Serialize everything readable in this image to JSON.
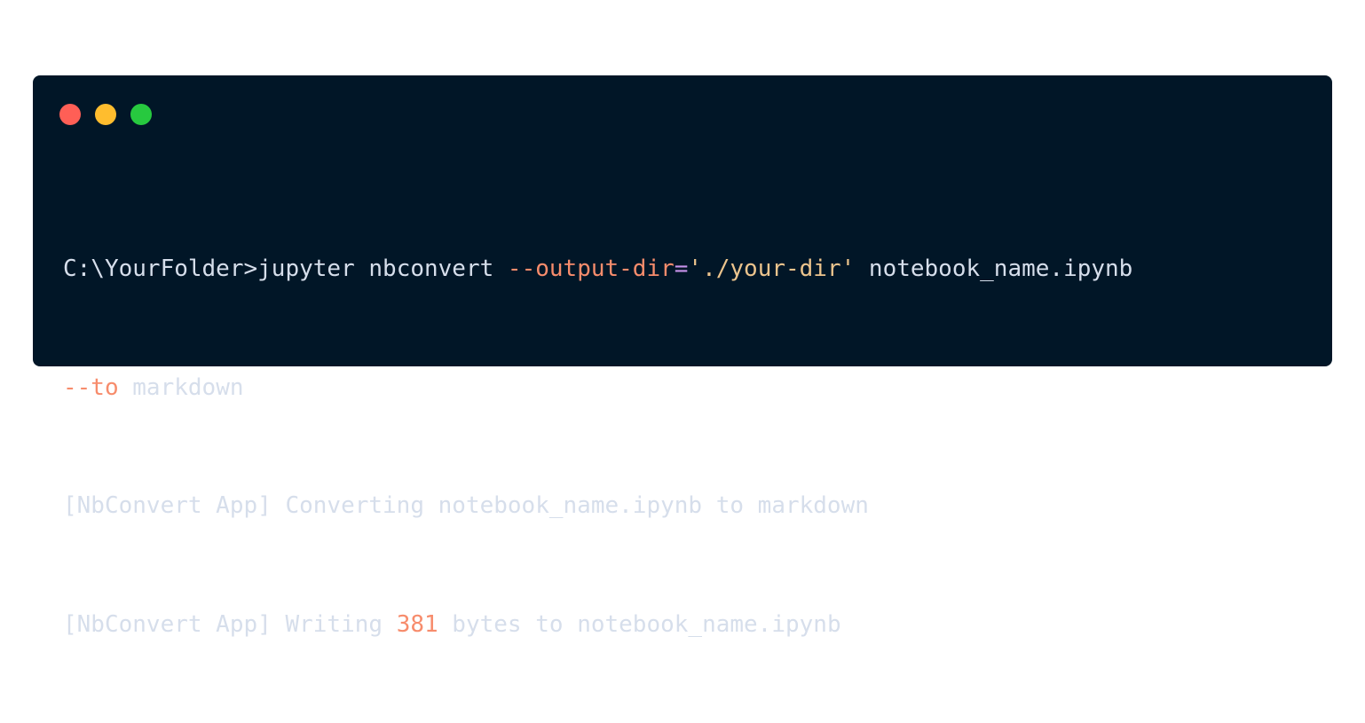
{
  "colors": {
    "background": "#011627",
    "text": "#d6deeb",
    "flag": "#f78c6c",
    "operator": "#c792ea",
    "string": "#ecc48d",
    "number": "#f78c6c",
    "dot_red": "#ff5f56",
    "dot_yellow": "#ffbd2e",
    "dot_green": "#27c93f"
  },
  "window_controls": [
    "close",
    "minimize",
    "maximize"
  ],
  "terminal": {
    "line1": {
      "prompt": "C:\\YourFolder>",
      "command": "jupyter nbconvert ",
      "flag": "--output-dir",
      "equals": "=",
      "string": "'./your-dir'",
      "rest": " notebook_name.ipynb"
    },
    "line2": {
      "flag": "--to",
      "rest": " markdown"
    },
    "line3": {
      "text": "[NbConvert App] Converting notebook_name.ipynb to markdown"
    },
    "line4": {
      "prefix": "[NbConvert App] Writing ",
      "number": "381",
      "suffix": " bytes to notebook_name.ipynb"
    }
  }
}
